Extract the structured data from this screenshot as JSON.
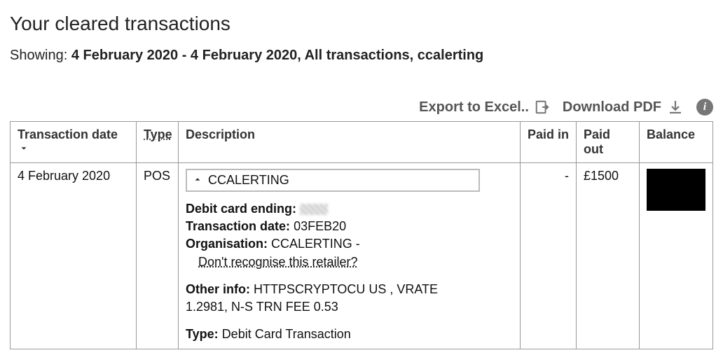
{
  "title": "Your cleared transactions",
  "filter": {
    "prefix": "Showing:",
    "summary": "4 February 2020 - 4 February 2020, All transactions, ccalerting"
  },
  "actions": {
    "export_label": "Export to Excel..",
    "pdf_label": "Download PDF"
  },
  "columns": {
    "date": "Transaction date",
    "type": "Type",
    "description": "Description",
    "paid_in": "Paid in",
    "paid_out": "Paid out",
    "balance": "Balance"
  },
  "rows": [
    {
      "date": "4 February 2020",
      "type": "POS",
      "summary": "CCALERTING",
      "paid_in": "-",
      "paid_out": "£1500",
      "balance_hidden": true,
      "details": {
        "debit_card_ending_label": "Debit card ending:",
        "debit_card_ending_value": "",
        "txn_date_label": "Transaction date:",
        "txn_date_value": "03FEB20",
        "org_label": "Organisation:",
        "org_value": "CCALERTING -",
        "retailer_link": "Don't recognise this retailer?",
        "other_info_label": "Other info:",
        "other_info_value": "HTTPSCRYPTOCU US , VRATE 1.2981, N-S TRN FEE 0.53",
        "type_label": "Type:",
        "type_value": "Debit Card Transaction"
      }
    }
  ]
}
